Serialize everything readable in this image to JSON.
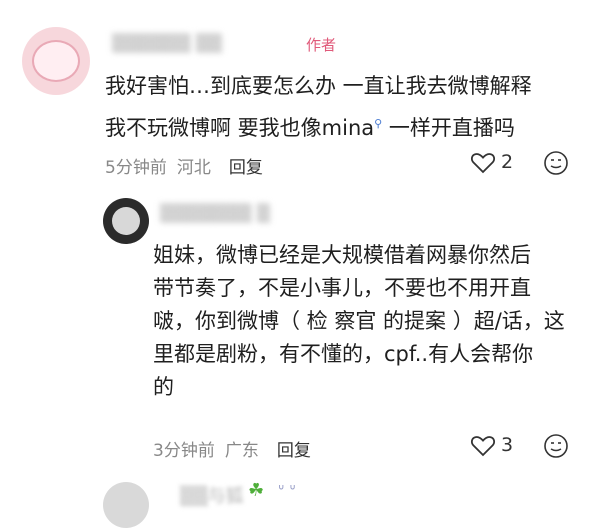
{
  "comment": {
    "author_tag": "作者",
    "line1": "我好害怕…到底要怎么办 一直让我去微博解释",
    "line2a": "我不玩微博啊 要我也像mina",
    "line2b": " 一样开直播吗",
    "time": "5分钟前",
    "location": "河北",
    "reply_label": "回复",
    "likes": "2"
  },
  "reply": {
    "lines": [
      "姐妹，微博已经是大规模借着网暴你然后",
      "带节奏了，不是小事儿，不要也不用开直",
      "啵，你到微博（ 检 察官 的提案 ）超/话，这",
      "里都是剧粉，有不懂的，cpf..有人会帮你",
      "的"
    ],
    "time": "3分钟前",
    "location": "广东",
    "reply_label": "回复",
    "likes": "3"
  },
  "icons": {
    "like": "heart-icon",
    "react": "smiley-icon",
    "search_link": "search-icon"
  },
  "colors": {
    "author_tag": "#e05a7a",
    "meta": "#888888",
    "link_icon": "#4a7bd1"
  }
}
